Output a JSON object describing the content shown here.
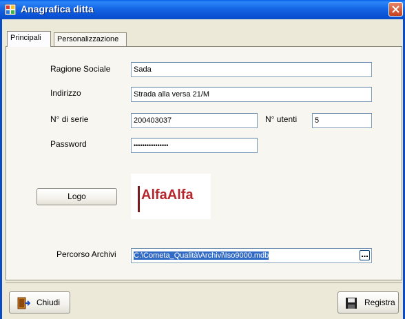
{
  "window": {
    "title": "Anagrafica ditta"
  },
  "tabs": [
    {
      "label": "Principali"
    },
    {
      "label": "Personalizzazione"
    }
  ],
  "form": {
    "ragione_sociale": {
      "label": "Ragione Sociale",
      "value": "Sada"
    },
    "indirizzo": {
      "label": "Indirizzo",
      "value": "Strada alla versa 21/M"
    },
    "numero_serie": {
      "label": "N° di serie",
      "value": "200403037"
    },
    "numero_utenti": {
      "label": "N° utenti",
      "value": "5"
    },
    "password": {
      "label": "Password",
      "value": "••••••••••••••••"
    },
    "logo_button": {
      "label": "Logo"
    },
    "logo_image_text": "AlfaAlfa",
    "percorso_archivi": {
      "label": "Percorso Archivi",
      "value": "C:\\Cometa_Qualità\\Archivi\\Iso9000.mdb"
    }
  },
  "footer": {
    "close_label": "Chiudi",
    "save_label": "Registra"
  },
  "colors": {
    "titlebar": "#0A4CC6",
    "logo_text": "#B5272D",
    "selection": "#316AC5"
  }
}
